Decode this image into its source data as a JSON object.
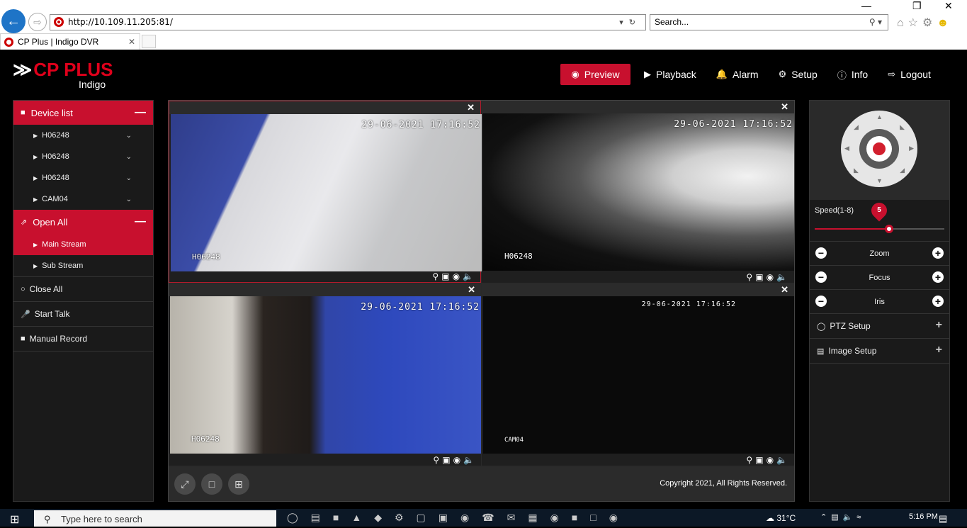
{
  "browser": {
    "url": "http://10.109.11.205:81/",
    "search_placeholder": "Search...",
    "tab_title": "CP Plus | Indigo DVR"
  },
  "app": {
    "logo": "CP PLUS",
    "logo_sub": "Indigo",
    "nav": {
      "preview": "Preview",
      "playback": "Playback",
      "alarm": "Alarm",
      "setup": "Setup",
      "info": "Info",
      "logout": "Logout"
    }
  },
  "left": {
    "device_list": "Device list",
    "devices": [
      "H06248",
      "H06248",
      "H06248",
      "CAM04"
    ],
    "open_all": "Open All",
    "main_stream": "Main Stream",
    "sub_stream": "Sub Stream",
    "close_all": "Close All",
    "start_talk": "Start Talk",
    "manual_record": "Manual Record"
  },
  "grid": {
    "cells": [
      {
        "timestamp": "29-06-2021 17:16:52",
        "name": "H06248"
      },
      {
        "timestamp": "29-06-2021 17:16:52",
        "name": "H06248"
      },
      {
        "timestamp": "29-06-2021 17:16:52",
        "name": "H06248"
      },
      {
        "timestamp": "29-06-2021 17:16:52",
        "name": "CAM04"
      }
    ],
    "copyright": "Copyright 2021, All Rights Reserved."
  },
  "right": {
    "speed_label": "Speed(1-8)",
    "speed_value": "5",
    "speed_min": 1,
    "speed_max": 8,
    "zoom": "Zoom",
    "focus": "Focus",
    "iris": "Iris",
    "ptz_setup": "PTZ Setup",
    "image_setup": "Image Setup"
  },
  "taskbar": {
    "search_placeholder": "Type here to search",
    "weather": "31°C",
    "time": "5:16 PM"
  },
  "colors": {
    "accent": "#c8102e",
    "background": "#000000",
    "panel": "#1a1a1a"
  }
}
